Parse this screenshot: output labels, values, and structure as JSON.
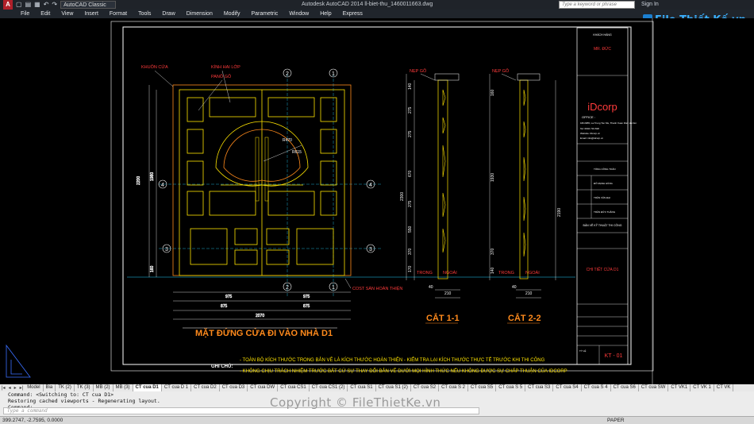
{
  "titlebar": {
    "app_logo": "A",
    "workspace": "AutoCAD Classic",
    "window_title": "Autodesk AutoCAD 2014   ll-biet-thu_1460011663.dwg",
    "search_placeholder": "Type a keyword or phrase",
    "sign_in": "Sign In"
  },
  "menu": [
    "File",
    "Edit",
    "View",
    "Insert",
    "Format",
    "Tools",
    "Draw",
    "Dimension",
    "Modify",
    "Parametric",
    "Window",
    "Help",
    "Express"
  ],
  "drawing": {
    "labels": {
      "frame": "KHUÔN CỬA",
      "glass": "KÍNH HAI LỚP",
      "panel": "PANÔ GỖ",
      "trim1": "NẸP GỖ",
      "trim2": "NẸP GỖ",
      "floor": "COST SÀN HOÀN THIỆN",
      "inside1": "TRONG",
      "outside1": "NGOÀI",
      "inside2": "TRONG",
      "outside2": "NGOÀI",
      "r615": "R615",
      "r470": "R470"
    },
    "axis_marks": [
      "2",
      "1",
      "4",
      "4",
      "3",
      "3",
      "2",
      "1"
    ],
    "dims_bottom": [
      "975",
      "975",
      "875",
      "875",
      "2070"
    ],
    "dims_left": [
      "2200",
      "1980",
      "160"
    ],
    "section1_dims": [
      "140",
      "275",
      "275",
      "670",
      "275",
      "550",
      "370",
      "170",
      "210",
      "2300",
      "40"
    ],
    "section2_dims": [
      "160",
      "1930",
      "2190",
      "370",
      "140",
      "210",
      "40"
    ],
    "title_main": "MẶT ĐỨNG CỬA ĐI VÀO NHÀ D1",
    "title_cut1": "CẮT 1-1",
    "title_cut2": "CẮT 2-2",
    "notes_label": "GHI CHÚ:",
    "note1": "- TOÀN BỘ KÍCH THƯỚC TRONG BẢN VẼ LÀ KÍCH THƯỚC HOÀN THIỆN - KIỂM TRA LẠI KÍCH THƯỚC THỰC TẾ TRƯỚC KHI THI CÔNG",
    "note2": "- KHÔNG CHỊU TRÁCH NHIỆM TRƯỚC BẤT CỨ SỰ THAY ĐỔI BẢN VẼ DƯỚI MỌI HÌNH THỨC NẾU KHÔNG ĐƯỢC SỰ CHẤP THUẬN CỦA IDCORP"
  },
  "titleblock": {
    "project_label": "KHÁCH HÀNG",
    "owner": "MR. ĐỨC",
    "company": "iDcorp",
    "office_label": "OFFICE :",
    "office_address": "18/1/3B5, La Trung Ton Ms, Thanh Xuan Dist, Ha Noi",
    "tel": "Tel: 0904 719 818",
    "website": "Website: iDcorp.vn",
    "email": "Email: info@idcorp.vn",
    "director": "TỔNG CÔNG TOÀN",
    "manager": "ĐỖ MẠNH HÙNG",
    "drawer": "TRẦN VĂN ĐẠI",
    "checker": "TRẦN ĐỨC THẮNG",
    "drawing_type": "BẢN VẼ KỸ THUẬT THI CÔNG",
    "drawing_name": "CHI TIẾT CỬA D1",
    "sheet_no": "KT - 01",
    "scale_label": "TỶ LỆ"
  },
  "tabs": [
    "Model",
    "Bia",
    "TK (2)",
    "TK (3)",
    "MB (2)",
    "MB (3)",
    "CT cua D1",
    "CT cua D 1",
    "CT cua D2",
    "CT cua D3",
    "CT cua DW",
    "CT cua CS1",
    "CT cua CS1 (2)",
    "CT cua S1",
    "CT cua S1 (2)",
    "CT cua S2",
    "CT cua S 2",
    "CT cua S5",
    "CT cua S 5",
    "CT cua S3",
    "CT cua S4",
    "CT cua S 4",
    "CT cua S6",
    "CT cua SW",
    "CT VK1",
    "CT VK 1",
    "CT VK"
  ],
  "active_tab": "CT cua D1",
  "command": {
    "line1": "Command:  <Switching to: CT cua D1>",
    "line2": "Restoring cached viewports - Regenerating layout.",
    "line3": "Command:",
    "placeholder": "Type a command"
  },
  "watermark": "Copyright © FileThietKe.vn",
  "brand": "File Thiết Kế.vn",
  "status": {
    "coords": "399.2747, -2.7595, 0.0000",
    "paper": "PAPER"
  },
  "colors": {
    "cad_red": "#ff3b3b",
    "cad_orange": "#ff8a1c",
    "cad_yellow": "#ffe400",
    "cad_cyan": "#23d0ff",
    "cad_white": "#ffffff",
    "cad_green": "#4cff5a"
  }
}
